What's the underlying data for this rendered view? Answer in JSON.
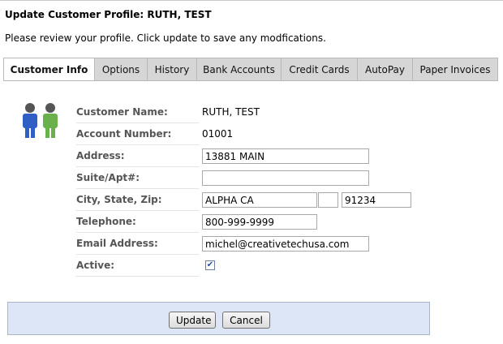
{
  "page": {
    "title": "Update Customer Profile: RUTH, TEST",
    "instructions": "Please review your profile. Click update to save any modfications."
  },
  "tabs": [
    {
      "label": "Customer Info",
      "active": true
    },
    {
      "label": "Options",
      "active": false
    },
    {
      "label": "History",
      "active": false
    },
    {
      "label": "Bank Accounts",
      "active": false
    },
    {
      "label": "Credit Cards",
      "active": false
    },
    {
      "label": "AutoPay",
      "active": false
    },
    {
      "label": "Paper Invoices",
      "active": false
    }
  ],
  "avatar_icon": "users-icon",
  "form": {
    "customer_name": {
      "label": "Customer Name:",
      "value": "RUTH, TEST"
    },
    "account_number": {
      "label": "Account Number:",
      "value": "01001"
    },
    "address": {
      "label": "Address:",
      "value": "13881 MAIN"
    },
    "suite": {
      "label": "Suite/Apt#:",
      "value": ""
    },
    "city_state_zip": {
      "label": "City, State, Zip:",
      "city": "ALPHA CA",
      "state": "",
      "zip": "91234"
    },
    "telephone": {
      "label": "Telephone:",
      "value": "800-999-9999"
    },
    "email": {
      "label": "Email Address:",
      "value": "michel@creativetechusa.com"
    },
    "active": {
      "label": "Active:",
      "checked": true
    }
  },
  "buttons": {
    "update": "Update",
    "cancel": "Cancel"
  },
  "colors": {
    "footer_bg": "#dce6f7",
    "tab_inactive": "#d6d6d6",
    "label_text": "#555555"
  }
}
